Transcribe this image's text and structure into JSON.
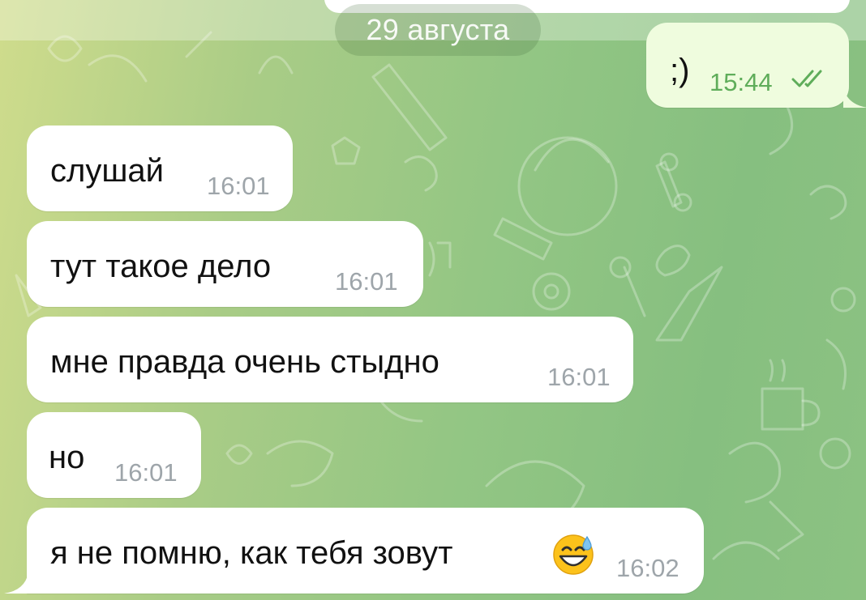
{
  "chat": {
    "date_separator": "29 августа",
    "outgoing": {
      "text": ";)",
      "time": "15:44",
      "status_icon": "double-check-icon"
    },
    "messages": [
      {
        "text": "слушай",
        "time": "16:01"
      },
      {
        "text": "тут такое дело",
        "time": "16:01"
      },
      {
        "text": "мне правда очень стыдно",
        "time": "16:01"
      },
      {
        "text": "но",
        "time": "16:01"
      },
      {
        "text": "я не помню, как тебя зовут",
        "time": "16:02",
        "emoji": "sweat-smile-emoji"
      }
    ]
  },
  "colors": {
    "incoming_bubble": "#ffffff",
    "outgoing_bubble": "#effcde",
    "outgoing_meta": "#5fad5a",
    "incoming_time": "#9ea5aa"
  }
}
